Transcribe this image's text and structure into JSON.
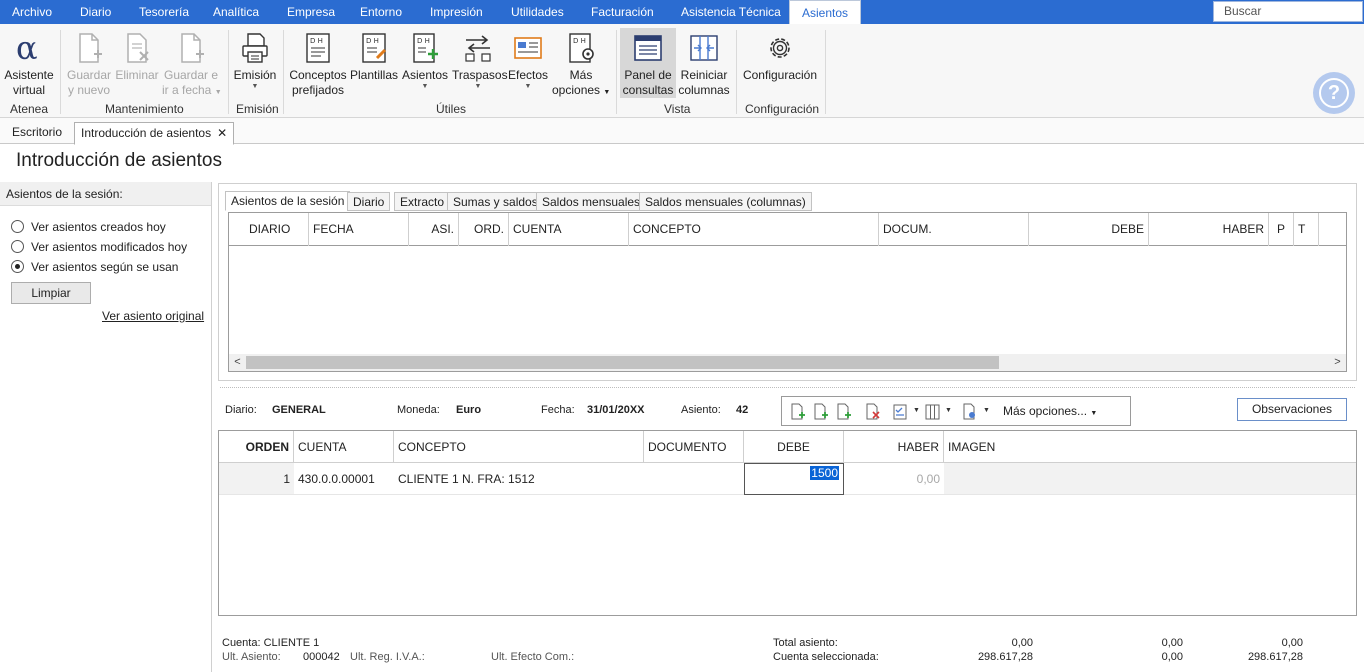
{
  "menu": {
    "items": [
      "Archivo",
      "Diario",
      "Tesorería",
      "Analítica",
      "Empresa",
      "Entorno",
      "Impresión",
      "Utilidades",
      "Facturación",
      "Asistencia Técnica"
    ],
    "active": "Asientos",
    "search_placeholder": "Buscar"
  },
  "ribbon": {
    "asistente": [
      "Asistente",
      "virtual"
    ],
    "guardar_nuevo": [
      "Guardar",
      "y nuevo"
    ],
    "eliminar": "Eliminar",
    "guardar_fecha": [
      "Guardar e",
      "ir a fecha"
    ],
    "emision": "Emisión",
    "conceptos": [
      "Conceptos",
      "prefijados"
    ],
    "plantillas": "Plantillas",
    "asientos": "Asientos",
    "traspasos": "Traspasos",
    "efectos": "Efectos",
    "mas_opciones": [
      "Más",
      "opciones"
    ],
    "panel": [
      "Panel de",
      "consultas"
    ],
    "reiniciar": [
      "Reiniciar",
      "columnas"
    ],
    "configuracion": "Configuración",
    "groups": {
      "atenea": "Atenea",
      "mantenimiento": "Mantenimiento",
      "emision": "Emisión",
      "utiles": "Útiles",
      "vista": "Vista",
      "configuracion": "Configuración"
    }
  },
  "doc_tabs": {
    "escritorio": "Escritorio",
    "introduccion": "Introducción de asientos"
  },
  "page_title": "Introducción de asientos",
  "session": {
    "header": "Asientos de la sesión:",
    "options": [
      "Ver asientos creados hoy",
      "Ver asientos modificados hoy",
      "Ver asientos según se usan"
    ],
    "selected_index": 2,
    "clear_button": "Limpiar",
    "original_link": "Ver asiento original"
  },
  "grid_tabs": [
    "Asientos de la sesión",
    "Diario",
    "Extracto",
    "Sumas y saldos",
    "Saldos mensuales",
    "Saldos mensuales (columnas)"
  ],
  "upper_columns": [
    "DIARIO",
    "FECHA",
    "ASI.",
    "ORD.",
    "CUENTA",
    "CONCEPTO",
    "DOCUM.",
    "DEBE",
    "HABER",
    "P",
    "T"
  ],
  "entry": {
    "diario_label": "Diario:",
    "diario": "GENERAL",
    "moneda_label": "Moneda:",
    "moneda": "Euro",
    "fecha_label": "Fecha:",
    "fecha": "31/01/20XX",
    "asiento_label": "Asiento:",
    "asiento": "42",
    "mas_opciones": "Más opciones...",
    "observaciones": "Observaciones"
  },
  "lower_grid": {
    "columns": [
      "ORDEN",
      "CUENTA",
      "CONCEPTO",
      "DOCUMENTO",
      "DEBE",
      "HABER",
      "IMAGEN"
    ],
    "rows": [
      {
        "orden": "1",
        "cuenta": "430.0.0.00001",
        "concepto": "CLIENTE 1 N. FRA:  1512",
        "documento": "",
        "debe": "1500",
        "haber": "0,00",
        "imagen": ""
      }
    ]
  },
  "footer": {
    "cuenta": "Cuenta: CLIENTE 1",
    "ult_asiento_label": "Ult. Asiento:",
    "ult_asiento": "000042",
    "ult_reg_iva": "Ult. Reg. I.V.A.:",
    "ult_efecto": "Ult. Efecto Com.:",
    "total_asiento_label": "Total asiento:",
    "cuenta_sel_label": "Cuenta seleccionada:",
    "total": [
      "0,00",
      "0,00",
      "0,00"
    ],
    "seleccionada": [
      "298.617,28",
      "0,00",
      "298.617,28"
    ]
  },
  "colors": {
    "menubar": "#2b6cd1",
    "help": "#b4c9ee",
    "selection": "#0a64d6"
  }
}
